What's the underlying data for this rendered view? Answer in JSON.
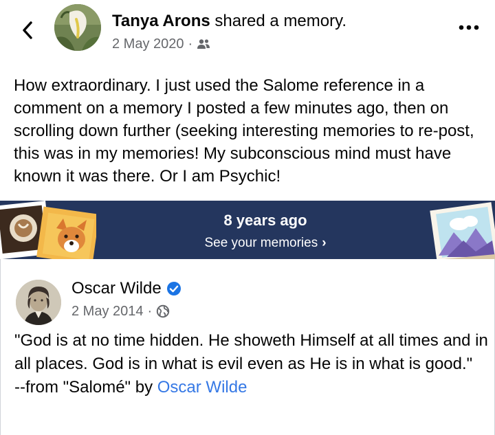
{
  "header": {
    "author_name": "Tanya Arons",
    "action": " shared a memory.",
    "date": "2 May 2020",
    "separator": "·",
    "audience_icon": "friends-icon",
    "back_icon": "chevron-left-icon",
    "more_icon": "more-horizontal-icon",
    "avatar": "arum-lily-photo"
  },
  "post": {
    "text": "How extraordinary.  I just used the Salome reference in a comment on a memory I posted a few minutes ago, then on scrolling down further (seeking interesting memories to re-post, this was in my memories!  My subconscious mind must have known it was there. Or I am Psychic!"
  },
  "memories_banner": {
    "title": "8 years ago",
    "link_label": "See your memories",
    "chevron": "›",
    "background_color": "#24365e"
  },
  "memory_post": {
    "author_name": "Oscar Wilde",
    "verified": true,
    "date": "2 May 2014",
    "separator": "·",
    "audience_icon": "globe-icon",
    "quote": "\"God is at no time hidden. He showeth Himself at all times and in all places. God is in what is evil even as He is in what is good.\"",
    "attribution_prefix": "--from \"Salomé\" by ",
    "attribution_link": "Oscar Wilde",
    "link_color": "#3578e5"
  }
}
